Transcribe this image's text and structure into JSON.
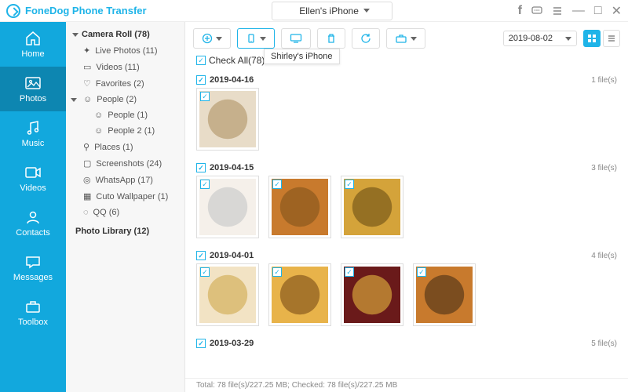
{
  "app_title": "FoneDog Phone Transfer",
  "device": "Ellen's iPhone",
  "nav": [
    {
      "label": "Home"
    },
    {
      "label": "Photos"
    },
    {
      "label": "Music"
    },
    {
      "label": "Videos"
    },
    {
      "label": "Contacts"
    },
    {
      "label": "Messages"
    },
    {
      "label": "Toolbox"
    }
  ],
  "tree": {
    "root": "Camera Roll (78)",
    "items": [
      {
        "label": "Live Photos (11)"
      },
      {
        "label": "Videos (11)"
      },
      {
        "label": "Favorites (2)"
      },
      {
        "label": "People (2)"
      },
      {
        "label": "People (1)"
      },
      {
        "label": "People 2 (1)"
      },
      {
        "label": "Places (1)"
      },
      {
        "label": "Screenshots (24)"
      },
      {
        "label": "WhatsApp (17)"
      },
      {
        "label": "Cuto Wallpaper (1)"
      },
      {
        "label": "QQ (6)"
      }
    ],
    "library": "Photo Library (12)"
  },
  "tooltip": "Shirley's iPhone",
  "date_filter": "2019-08-02",
  "check_all": "Check All(78)",
  "groups": [
    {
      "date": "2019-04-16",
      "count": "1 file(s)",
      "n": 1
    },
    {
      "date": "2019-04-15",
      "count": "3 file(s)",
      "n": 3
    },
    {
      "date": "2019-04-01",
      "count": "4 file(s)",
      "n": 4
    },
    {
      "date": "2019-03-29",
      "count": "5 file(s)",
      "n": 0
    }
  ],
  "status": "Total: 78 file(s)/227.25 MB; Checked: 78 file(s)/227.25 MB"
}
